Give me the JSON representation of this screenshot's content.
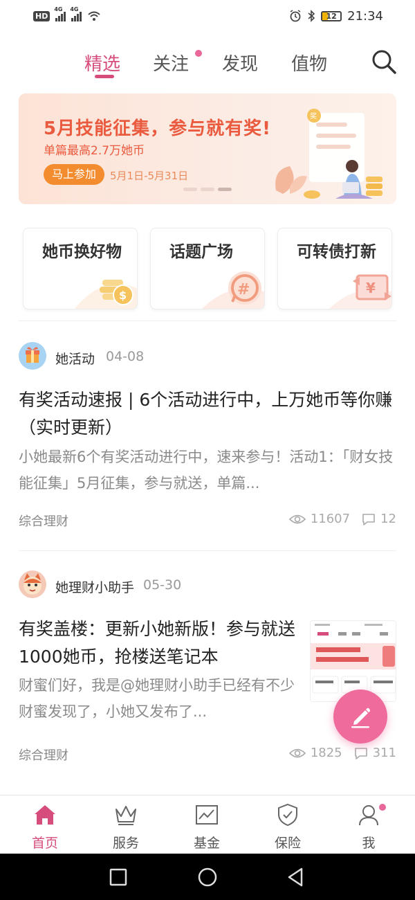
{
  "status_bar": {
    "hd": "HD",
    "net1": "4G",
    "net2": "4G",
    "battery": "12",
    "time": "21:34"
  },
  "top_tabs": [
    {
      "label": "精选",
      "active": true
    },
    {
      "label": "关注",
      "active": false,
      "badge_dot": true
    },
    {
      "label": "发现",
      "active": false
    },
    {
      "label": "值物",
      "active": false
    }
  ],
  "banner": {
    "title": "5月技能征集，参与就有奖!",
    "subtitle": "单篇最高2.7万她币",
    "button": "马上参加",
    "date_range": "5月1日-5月31日",
    "page_count": 3,
    "active_page": 3
  },
  "quick_cards": [
    {
      "label": "她币换好物",
      "icon": "coin-stack-icon"
    },
    {
      "label": "话题广场",
      "icon": "hashtag-bubble-icon"
    },
    {
      "label": "可转债打新",
      "icon": "yen-exchange-icon"
    }
  ],
  "posts": [
    {
      "author": "她活动",
      "date": "04-08",
      "title": "有奖活动速报 | 6个活动进行中，上万她币等你赚（实时更新）",
      "excerpt": "小她最新6个有奖活动进行中，速来参与！活动1：「财女技能征集」5月征集，参与就送，单篇...",
      "tag": "综合理财",
      "views": "11607",
      "comments": "12"
    },
    {
      "author": "她理财小助手",
      "date": "05-30",
      "title": "有奖盖楼：更新小她新版！参与就送1000她币，抢楼送笔记本",
      "excerpt": "财蜜们好，我是@她理财小助手已经有不少财蜜发现了，小她又发布了...",
      "tag": "综合理财",
      "views": "1825",
      "comments": "311"
    }
  ],
  "bottom_nav": [
    {
      "label": "首页",
      "icon": "home-icon",
      "active": true
    },
    {
      "label": "服务",
      "icon": "crown-icon",
      "active": false
    },
    {
      "label": "基金",
      "icon": "chart-icon",
      "active": false
    },
    {
      "label": "保险",
      "icon": "shield-check-icon",
      "active": false
    },
    {
      "label": "我",
      "icon": "person-icon",
      "active": false,
      "badge_dot": true
    }
  ],
  "colors": {
    "accent": "#d64d7d",
    "fab": "#ee6b9c",
    "banner_text": "#ea5a3e",
    "banner_button": "#f38b2f"
  }
}
